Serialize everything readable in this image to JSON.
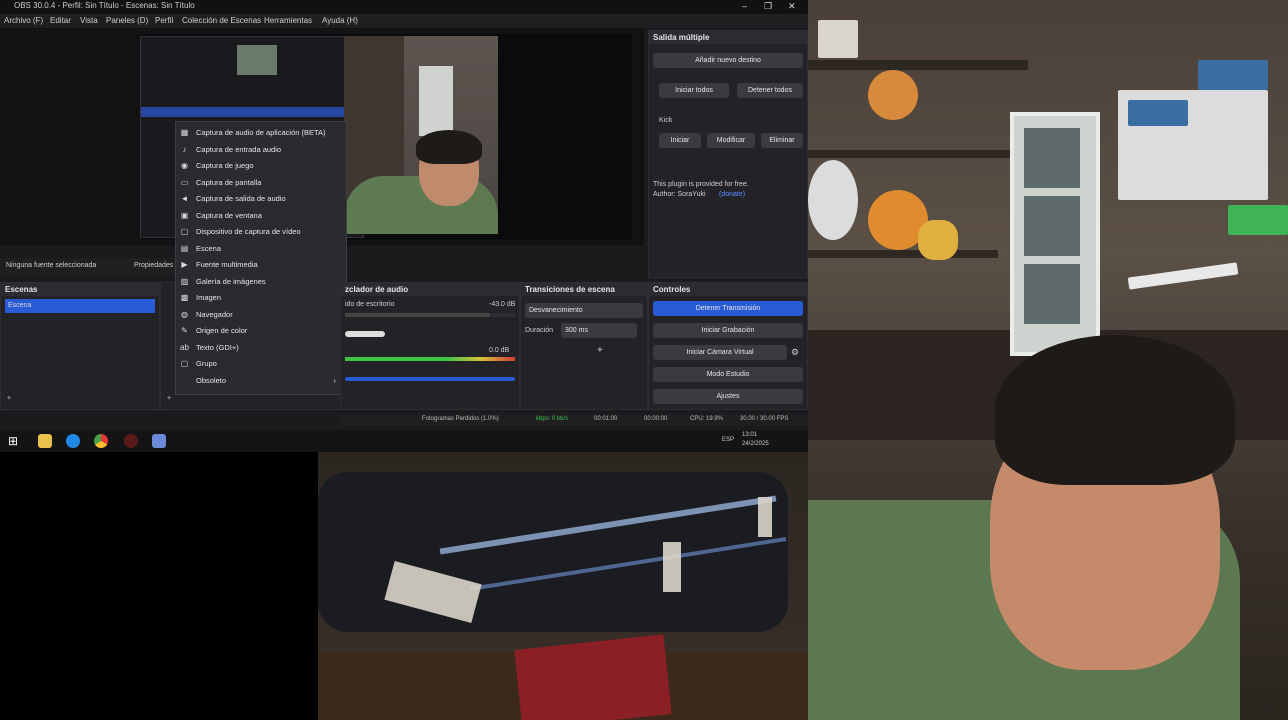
{
  "window": {
    "title": "OBS 30.0.4 - Perfil: Sin Título - Escenas: Sin Título",
    "minimize": "–",
    "maximize": "❐",
    "close": "✕"
  },
  "menubar": [
    "Archivo (F)",
    "Editar",
    "Vista",
    "Paneles (D)",
    "Perfil",
    "Colección de Escenas",
    "Herramientas",
    "Ayuda (H)"
  ],
  "source_bar": {
    "no_source": "Ninguna fuente seleccionada",
    "properties": "Propiedades"
  },
  "context_menu": {
    "items": [
      {
        "icon": "audio-capture-icon",
        "glyph": "▦",
        "label": "Captura de audio de aplicación (BETA)"
      },
      {
        "icon": "microphone-icon",
        "glyph": "♪",
        "label": "Captura de entrada audio"
      },
      {
        "icon": "gamepad-icon",
        "glyph": "◉",
        "label": "Captura de juego"
      },
      {
        "icon": "monitor-icon",
        "glyph": "▭",
        "label": "Captura de pantalla"
      },
      {
        "icon": "speaker-icon",
        "glyph": "◄",
        "label": "Captura de salida de audio"
      },
      {
        "icon": "window-icon",
        "glyph": "▣",
        "label": "Captura de ventana"
      },
      {
        "icon": "camera-icon",
        "glyph": "▢",
        "label": "Dispositivo de captura de vídeo"
      },
      {
        "icon": "scene-icon",
        "glyph": "▤",
        "label": "Escena"
      },
      {
        "icon": "media-icon",
        "glyph": "▶",
        "label": "Fuente multimedia"
      },
      {
        "icon": "gallery-icon",
        "glyph": "▨",
        "label": "Galería de imágenes"
      },
      {
        "icon": "image-icon",
        "glyph": "▩",
        "label": "Imagen"
      },
      {
        "icon": "browser-icon",
        "glyph": "◍",
        "label": "Navegador"
      },
      {
        "icon": "color-icon",
        "glyph": "✎",
        "label": "Origen de color"
      },
      {
        "icon": "text-icon",
        "glyph": "ab",
        "label": "Texto (GDI+)"
      },
      {
        "icon": "group-icon",
        "glyph": "▢",
        "label": "Grupo"
      },
      {
        "icon": "",
        "glyph": "",
        "label": "Obsoleto"
      }
    ]
  },
  "scenes_panel": {
    "title": "Escenas",
    "items": [
      "Escena"
    ]
  },
  "audio_panel": {
    "title": "zclador de audio",
    "channel1": {
      "label": "ido de escritorio",
      "level": "-43.0 dB"
    },
    "channel2": {
      "label": "",
      "level": "0.0 dB"
    }
  },
  "transitions_panel": {
    "title": "Transiciones de escena",
    "transition": "Desvanecimiento",
    "duration_label": "Duración",
    "duration_value": "300 ms"
  },
  "controls_panel": {
    "title": "Controles",
    "buttons": [
      "Detener Transmisión",
      "Iniciar Grabación",
      "Iniciar Cámara Virtual",
      "Modo Estudio",
      "Ajustes"
    ]
  },
  "multi_output": {
    "title": "Salida múltiple",
    "add_target": "Añadir nuevo destino",
    "start_all": "Iniciar todos",
    "stop_all": "Detener todos",
    "item_label": "Kick",
    "item_buttons": [
      "Iniciar",
      "Modificar",
      "Eliminar"
    ],
    "note": "This plugin is provided for free.",
    "author": "Author: SoraYuki",
    "link": "(donate)"
  },
  "statusbar": {
    "dropped": "Fotogramas Perdidos (1.0%)",
    "kbps": "kbps: 0 kb/s",
    "stream_time": "00:01:00",
    "rec_time": "00:00:00",
    "cpu": "CPU: 19.9%",
    "fps": "30.00 / 30.00 FPS"
  },
  "taskbar": {
    "time": "13:01",
    "date": "24/2/2025",
    "lang": "ESP"
  },
  "colors": {
    "accent": "#2a5bd7",
    "meter_green": "#3ec447",
    "meter_yellow": "#d7c33a",
    "meter_red": "#d33a3a"
  }
}
